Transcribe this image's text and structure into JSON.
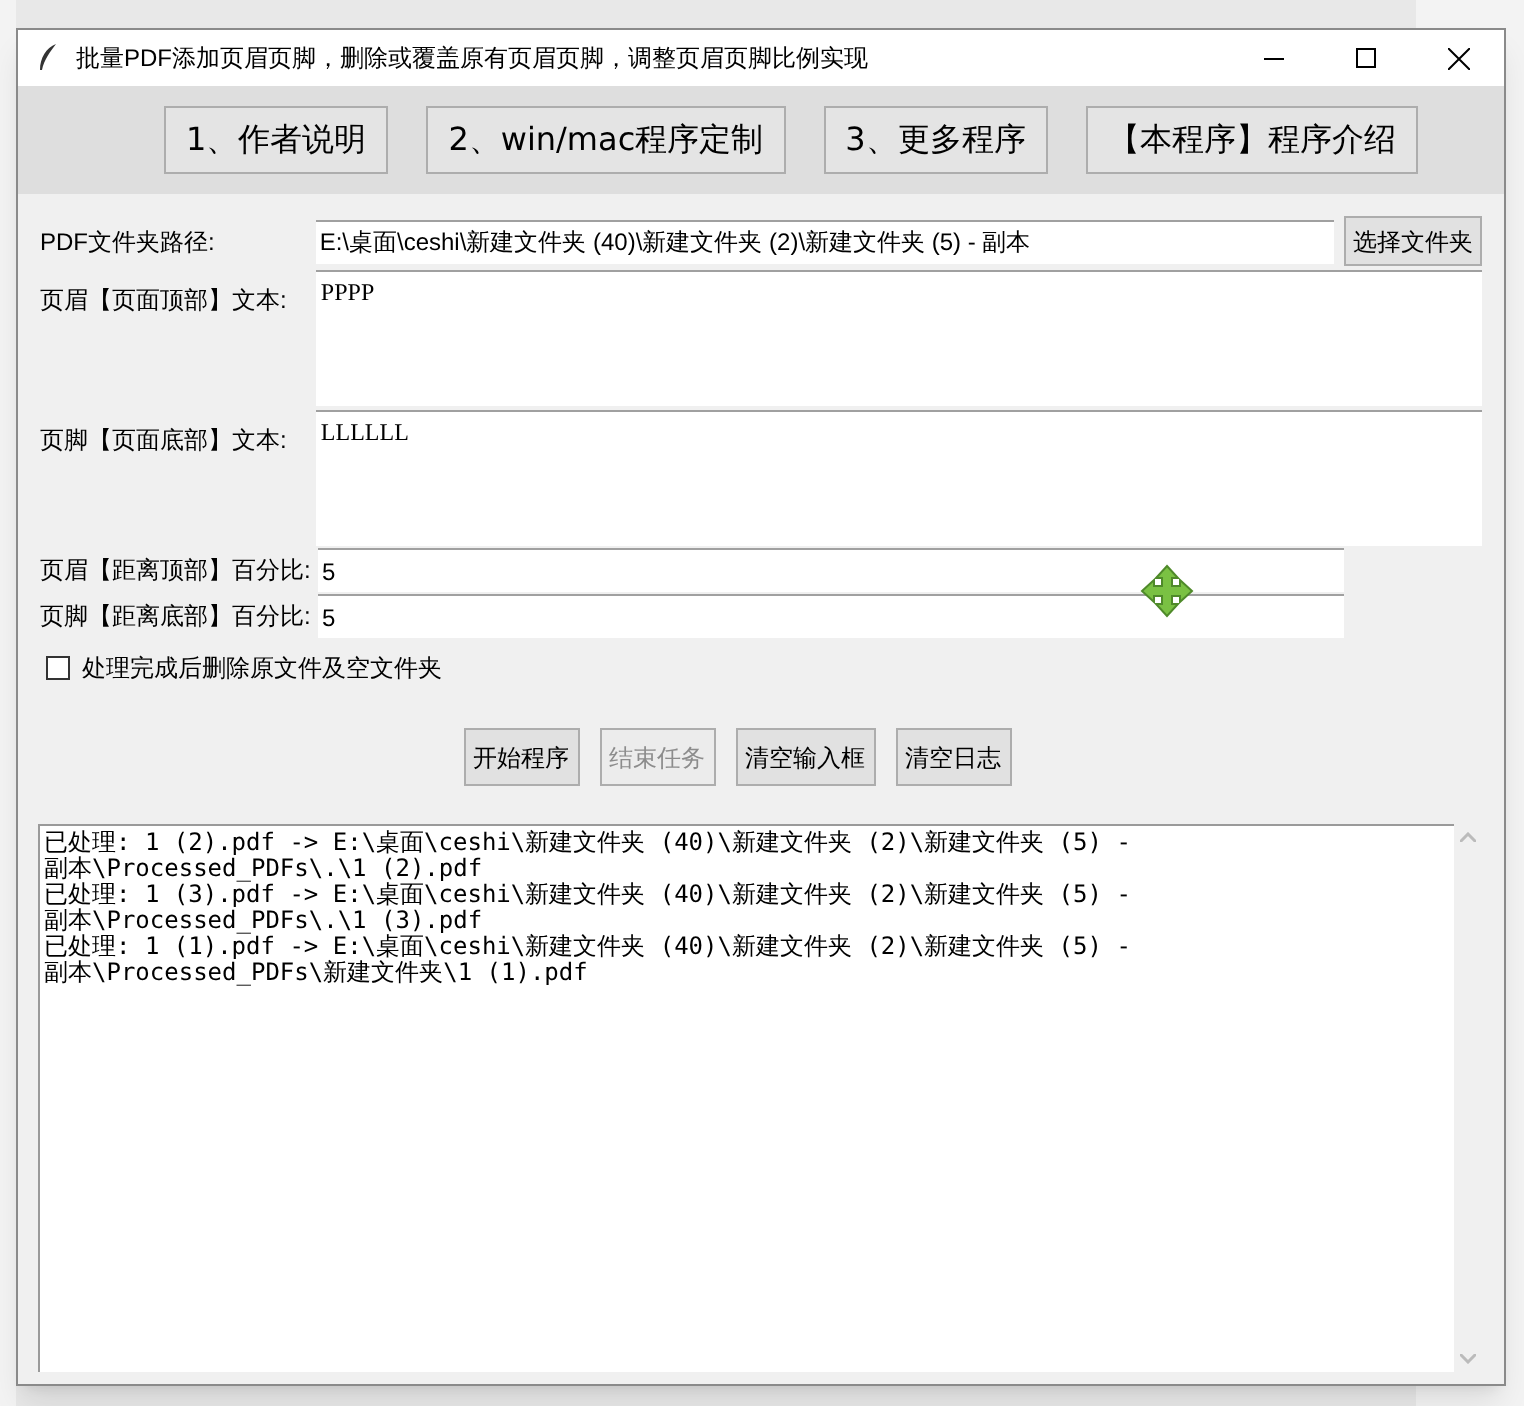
{
  "window": {
    "title": "批量PDF添加页眉页脚，删除或覆盖原有页眉页脚，调整页眉页脚比例实现"
  },
  "top_buttons": [
    "1、作者说明",
    "2、win/mac程序定制",
    "3、更多程序",
    "【本程序】程序介绍"
  ],
  "folder_path": {
    "label": "PDF文件夹路径:",
    "value": "E:\\桌面\\ceshi\\新建文件夹 (40)\\新建文件夹 (2)\\新建文件夹 (5) - 副本",
    "button": "选择文件夹"
  },
  "header_text": {
    "label": "页眉【页面顶部】文本:",
    "value": "PPPP"
  },
  "footer_text": {
    "label": "页脚【页面底部】文本:",
    "value": "LLLLLL"
  },
  "percent_fields": [
    {
      "label": "页眉【距离顶部】百分比:",
      "value": "5"
    },
    {
      "label": "页脚【距离底部】百分比:",
      "value": "5"
    }
  ],
  "delete_option": {
    "label": "处理完成后删除原文件及空文件夹",
    "checked": false
  },
  "action_buttons": [
    {
      "label": "开始程序",
      "disabled": false
    },
    {
      "label": "结束任务",
      "disabled": true
    },
    {
      "label": "清空输入框",
      "disabled": false
    },
    {
      "label": "清空日志",
      "disabled": false
    }
  ],
  "log_lines": [
    "已处理: 1 (2).pdf -> E:\\桌面\\ceshi\\新建文件夹 (40)\\新建文件夹 (2)\\新建文件夹 (5) -",
    "副本\\Processed_PDFs\\.\\1 (2).pdf",
    "已处理: 1 (3).pdf -> E:\\桌面\\ceshi\\新建文件夹 (40)\\新建文件夹 (2)\\新建文件夹 (5) -",
    "副本\\Processed_PDFs\\.\\1 (3).pdf",
    "已处理: 1 (1).pdf -> E:\\桌面\\ceshi\\新建文件夹 (40)\\新建文件夹 (2)\\新建文件夹 (5) -",
    "副本\\Processed_PDFs\\新建文件夹\\1 (1).pdf"
  ]
}
